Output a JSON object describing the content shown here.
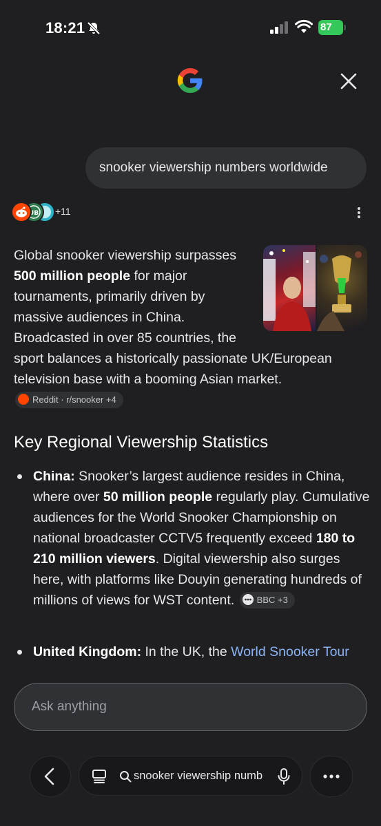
{
  "status_bar": {
    "time": "18:21",
    "battery": "87"
  },
  "query": "snooker viewership numbers worldwide",
  "sources": {
    "extra_count": "+11"
  },
  "intro": {
    "t1": "Global snooker viewership surpasses ",
    "b1": "500 million people",
    "t2": " for major tournaments, primarily driven by massive audiences in China. Broadcasted in over 85 countries, the sport balances a historically passionate UK/European television base with a booming Asian market. ",
    "chip": "Reddit · r/snooker +4"
  },
  "heading": "Key Regional Viewership Statistics",
  "bullet1": {
    "label": "China:",
    "t1": " Snooker’s largest audience resides in China, where over ",
    "b1": "50 million people",
    "t2": " regularly play. Cumulative audiences for the World Snooker Championship on national broadcaster CCTV5 frequently exceed ",
    "b2": "180 to 210 million viewers",
    "t3": ". Digital viewership also surges here, with platforms like Douyin generating hundreds of millions of views for WST content. ",
    "chip": "BBC +3"
  },
  "bullet2": {
    "label": "United Kingdom:",
    "t1": " In the UK, the ",
    "link": "World Snooker Tour"
  },
  "ask_placeholder": "Ask anything",
  "url_bar": {
    "text": "snooker viewership numb"
  },
  "icons": {
    "bell": "bell-off-icon",
    "close": "close-icon",
    "reddit": "reddit-icon",
    "back": "chevron-left-icon",
    "tabs": "tabs-icon",
    "search": "search-icon",
    "mic": "mic-icon",
    "menu": "more-horizontal-icon"
  },
  "colors": {
    "background": "#1f1f21",
    "link": "#8ab4f8",
    "battery": "#34c759",
    "reddit": "#ff4500"
  }
}
